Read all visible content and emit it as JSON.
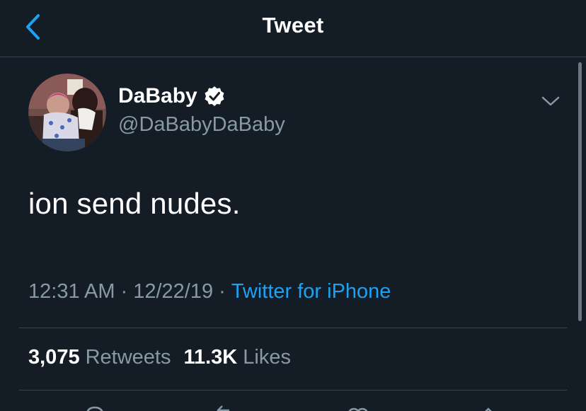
{
  "header": {
    "title": "Tweet",
    "back_icon": "chevron-left-icon"
  },
  "tweet": {
    "author": {
      "display_name": "DaBaby",
      "handle": "@DaBabyDaBaby",
      "verified": true,
      "avatar_icon": "profile-photo"
    },
    "text": "ion send nudes.",
    "time": "12:31 AM",
    "date": "12/22/19",
    "separator": "·",
    "source": "Twitter for iPhone",
    "retweets_count": "3,075",
    "retweets_label": "Retweets",
    "likes_count": "11.3K",
    "likes_label": "Likes"
  },
  "actions": [
    "reply-icon",
    "retweet-icon",
    "like-icon",
    "share-icon"
  ],
  "colors": {
    "background": "#141d26",
    "accent": "#1da1f2",
    "secondary_text": "#8899a6",
    "divider": "#38444d"
  }
}
